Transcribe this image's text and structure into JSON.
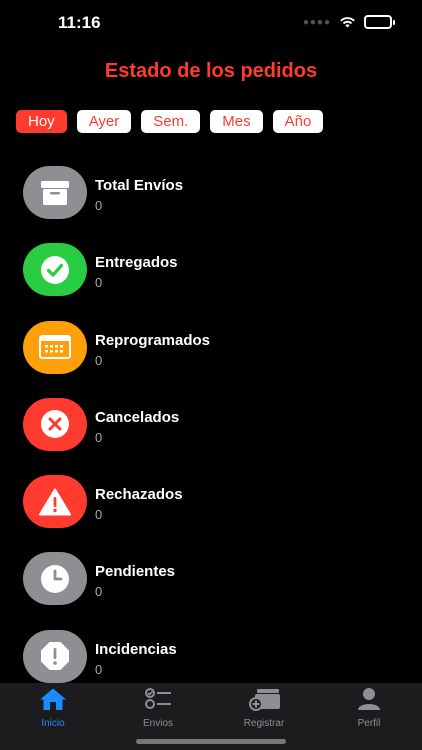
{
  "status": {
    "time": "11:16"
  },
  "page": {
    "title": "Estado de los pedidos"
  },
  "filters": [
    "Hoy",
    "Ayer",
    "Sem.",
    "Mes",
    "Año"
  ],
  "rows": [
    {
      "label": "Total Envíos",
      "value": "0",
      "color": "#8e8e93",
      "icon": "archive-box-icon"
    },
    {
      "label": "Entregados",
      "value": "0",
      "color": "#28cd41",
      "icon": "checkmark-icon"
    },
    {
      "label": "Reprogramados",
      "value": "0",
      "color": "#ff9f0a",
      "icon": "calendar-icon"
    },
    {
      "label": "Cancelados",
      "value": "0",
      "color": "#ff3b30",
      "icon": "x-circle-icon"
    },
    {
      "label": "Rechazados",
      "value": "0",
      "color": "#ff3b30",
      "icon": "warning-triangle-icon"
    },
    {
      "label": "Pendientes",
      "value": "0",
      "color": "#8e8e93",
      "icon": "clock-icon"
    },
    {
      "label": "Incidencias",
      "value": "0",
      "color": "#8e8e93",
      "icon": "exclamation-octagon-icon"
    }
  ],
  "tabs": [
    {
      "label": "Inicio",
      "icon": "house-icon",
      "active": true
    },
    {
      "label": "Envios",
      "icon": "checklist-icon",
      "active": false
    },
    {
      "label": "Registrar",
      "icon": "register-package-icon",
      "active": false
    },
    {
      "label": "Perfil",
      "icon": "person-icon",
      "active": false
    }
  ],
  "colors": {
    "accent_red": "#ff3b30",
    "tab_active": "#1a8cff",
    "tab_inactive": "#8e8e93"
  }
}
